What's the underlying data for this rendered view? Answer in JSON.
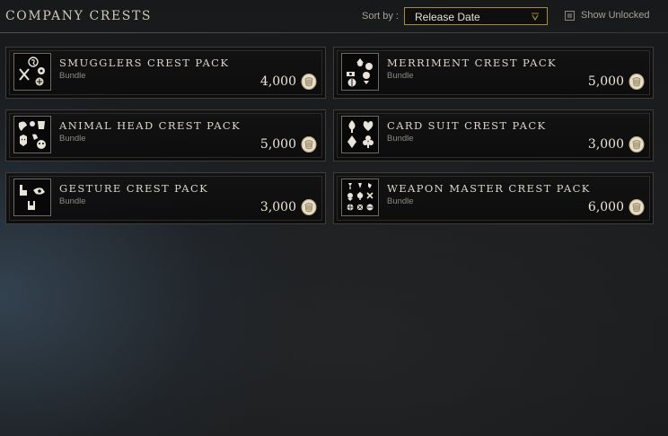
{
  "header": {
    "title": "COMPANY CRESTS",
    "sort_label": "Sort by :",
    "sort_value": "Release Date",
    "show_unlocked_label": "Show Unlocked",
    "show_unlocked_checked": false
  },
  "cards": [
    {
      "title": "SMUGGLERS CREST PACK",
      "subtitle": "Bundle",
      "price": "4,000",
      "thumb_icon": "smugglers-crest-icon"
    },
    {
      "title": "MERRIMENT CREST PACK",
      "subtitle": "Bundle",
      "price": "5,000",
      "thumb_icon": "merriment-crest-icon"
    },
    {
      "title": "ANIMAL HEAD CREST PACK",
      "subtitle": "Bundle",
      "price": "5,000",
      "thumb_icon": "animal-head-crest-icon"
    },
    {
      "title": "CARD SUIT CREST PACK",
      "subtitle": "Bundle",
      "price": "3,000",
      "thumb_icon": "card-suit-crest-icon"
    },
    {
      "title": "GESTURE CREST PACK",
      "subtitle": "Bundle",
      "price": "3,000",
      "thumb_icon": "gesture-crest-icon"
    },
    {
      "title": "WEAPON MASTER CREST PACK",
      "subtitle": "Bundle",
      "price": "6,000",
      "thumb_icon": "weapon-master-crest-icon"
    }
  ],
  "currency_icon": "marks-of-fortune-coin-icon",
  "colors": {
    "accent_border": "#a88a3c",
    "text": "#dcd6c8",
    "card_border": "#3f3d3a"
  }
}
